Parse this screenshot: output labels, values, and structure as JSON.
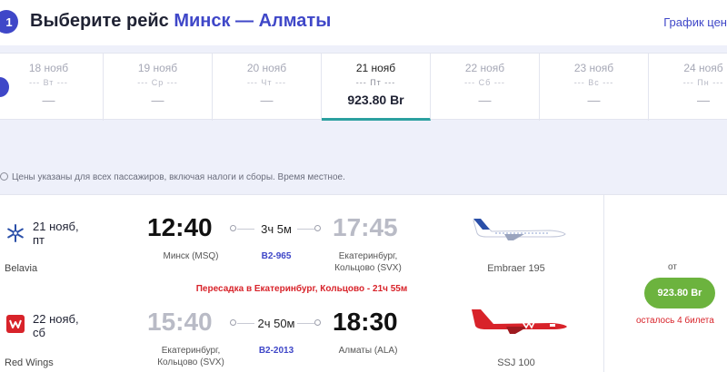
{
  "header": {
    "step": "1",
    "title": "Выберите рейс",
    "route": "Минск — Алматы",
    "schedule_link": "График цен"
  },
  "dates": [
    {
      "date": "18 нояб",
      "dow": "--- Вт ---",
      "price": "—",
      "active": false
    },
    {
      "date": "19 нояб",
      "dow": "--- Ср ---",
      "price": "—",
      "active": false
    },
    {
      "date": "20 нояб",
      "dow": "--- Чт ---",
      "price": "—",
      "active": false
    },
    {
      "date": "21 нояб",
      "dow": "--- Пт ---",
      "price": "923.80 Br",
      "active": true
    },
    {
      "date": "22 нояб",
      "dow": "--- Сб ---",
      "price": "—",
      "active": false
    },
    {
      "date": "23 нояб",
      "dow": "--- Вс ---",
      "price": "—",
      "active": false
    },
    {
      "date": "24 нояб",
      "dow": "--- Пн ---",
      "price": "—",
      "active": false
    }
  ],
  "note": "Цены указаны для всех пассажиров, включая налоги и сборы. Время местное.",
  "segments": [
    {
      "date_line1": "21 нояб,",
      "date_line2": "пт",
      "airline": "Belavia",
      "dep_time": "12:40",
      "duration": "3ч 5м",
      "arr_time": "17:45",
      "dep_city": "Минск (MSQ)",
      "flight_no": "B2-965",
      "arr_city_line1": "Екатеринбург,",
      "arr_city_line2": "Кольцово (SVX)",
      "aircraft": "Embraer 195"
    },
    {
      "date_line1": "22 нояб,",
      "date_line2": "сб",
      "airline": "Red Wings",
      "dep_time": "15:40",
      "duration": "2ч 50м",
      "arr_time": "18:30",
      "dep_city_line1": "Екатеринбург,",
      "dep_city_line2": "Кольцово (SVX)",
      "flight_no": "B2-2013",
      "arr_city": "Алматы (ALA)",
      "aircraft": "SSJ 100"
    }
  ],
  "transfer": "Пересадка в Екатеринбург, Кольцово - 21ч 55м",
  "price": {
    "from": "от",
    "amount": "923.80 Br",
    "seats_left": "осталось 4 билета"
  },
  "colors": {
    "accent": "#3f47c8",
    "price_button": "#6cb33e",
    "alert": "#d8232a",
    "active_underline": "#2ca0a0"
  }
}
